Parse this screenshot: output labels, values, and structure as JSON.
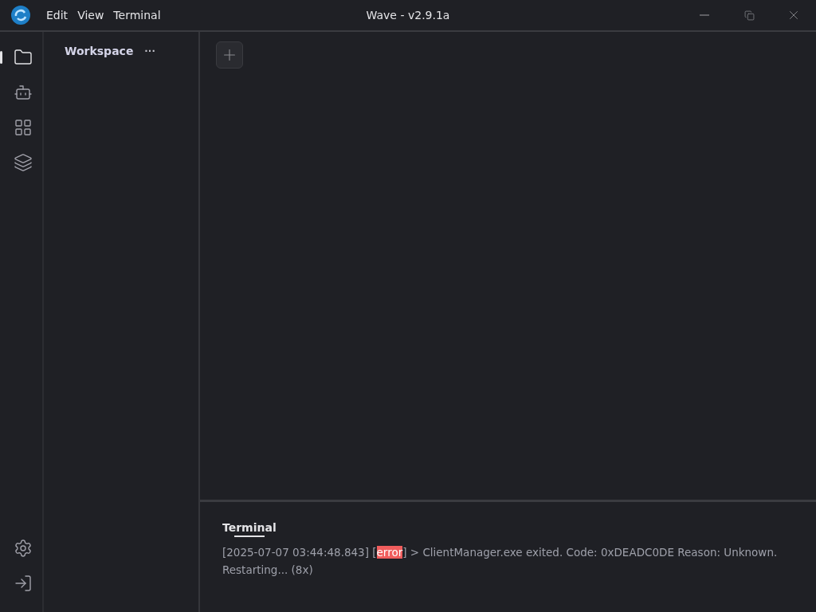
{
  "window": {
    "title": "Wave - v2.9.1a"
  },
  "menu": [
    "Edit",
    "View",
    "Terminal"
  ],
  "rail": {
    "items": [
      {
        "kind": "files",
        "selected": true
      },
      {
        "kind": "robot",
        "selected": false
      },
      {
        "kind": "apps",
        "selected": false
      },
      {
        "kind": "layers",
        "selected": false
      }
    ],
    "bottom": [
      {
        "kind": "settings"
      },
      {
        "kind": "logout"
      }
    ]
  },
  "sidebar": {
    "title": "Workspace",
    "more": "···"
  },
  "panel": {
    "tabs": [
      {
        "label": "Terminal",
        "selected": true
      }
    ],
    "log": [
      {
        "parts": [
          {
            "text": "[2025-07-07 03:44:48.843] ["
          },
          {
            "text": "error",
            "highlight": true
          },
          {
            "text": "] > ClientManager.exe exited. Code: 0xDEADC0DE Reason: Unknown. Restarting... (8x)"
          }
        ]
      }
    ]
  }
}
